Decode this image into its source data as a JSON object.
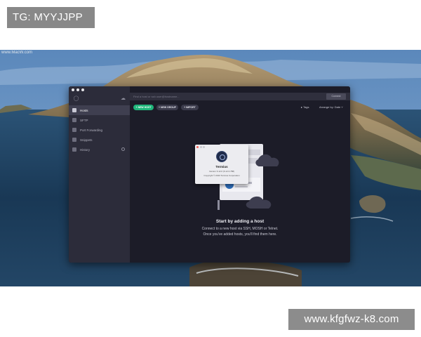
{
  "overlay": {
    "top_left_label": "TG: MYYJJPP",
    "bottom_right_label": "www.kfgfwz-k8.com"
  },
  "desktop": {
    "watermark": "www.MacW.com"
  },
  "app": {
    "search_placeholder": "Find a host or ssh user@hostname...",
    "connect_label": "Connect",
    "sidebar": [
      {
        "label": "Hosts",
        "icon": "grid-icon",
        "active": true
      },
      {
        "label": "SFTP",
        "icon": "folder-icon",
        "active": false
      },
      {
        "label": "Port Forwarding",
        "icon": "arrow-icon",
        "active": false
      },
      {
        "label": "Snippets",
        "icon": "snippet-icon",
        "active": false
      },
      {
        "label": "History",
        "icon": "clock-icon",
        "active": false
      }
    ],
    "toolbar": {
      "new_host": "+ NEW HOST",
      "new_group": "+ NEW GROUP",
      "import": "+ IMPORT",
      "tags": "Tags",
      "arrange": "Arrange by: Date"
    },
    "about": {
      "name": "Termius",
      "version": "Version 6.12.0 (6.12.0.788)",
      "copyright": "Copyright © 2020 Termius Corporation"
    },
    "empty_state": {
      "title": "Start by adding a host",
      "line1": "Connect to a new host via SSH, MOSH or Telnet.",
      "line2": "Once you've added hosts, you'll find them here."
    }
  },
  "colors": {
    "sidebar": "#2c2c3a",
    "main": "#1c1c28",
    "accent_green": "#1fb57a"
  }
}
